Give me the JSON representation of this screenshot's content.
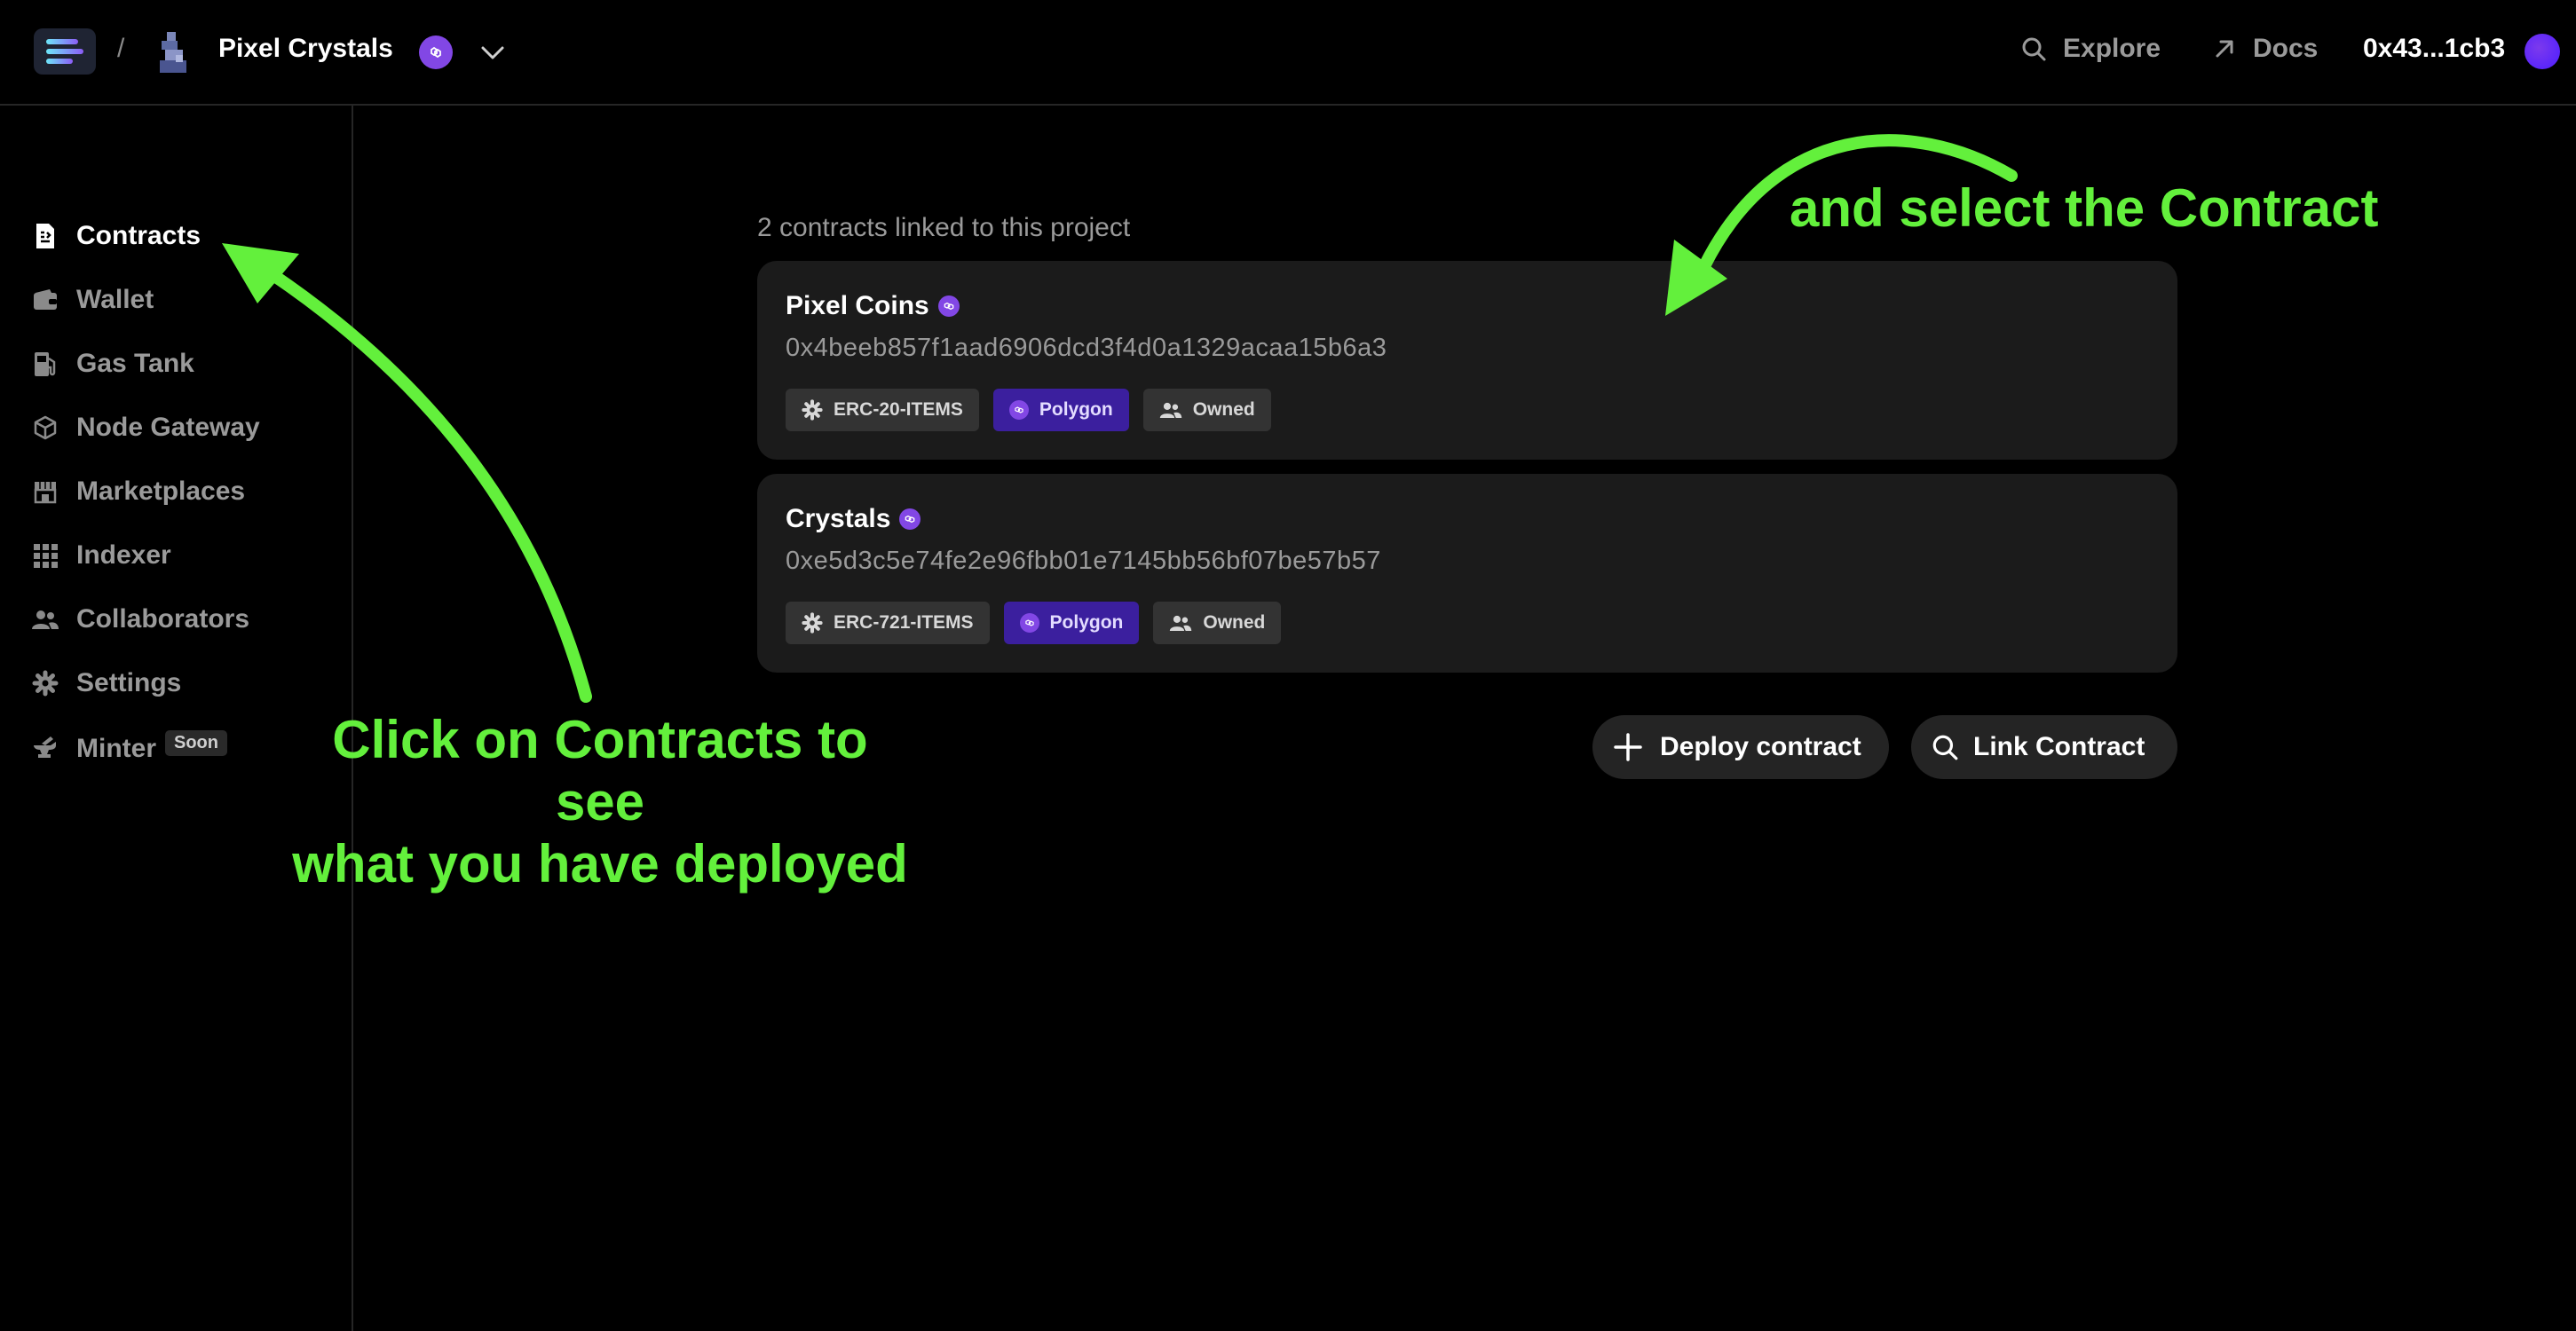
{
  "header": {
    "breadcrumb_sep": "/",
    "project_name": "Pixel Crystals",
    "explore_label": "Explore",
    "docs_label": "Docs",
    "wallet_address": "0x43...1cb3"
  },
  "sidebar": {
    "items": [
      {
        "label": "Contracts",
        "icon": "contracts-icon"
      },
      {
        "label": "Wallet",
        "icon": "wallet-icon"
      },
      {
        "label": "Gas Tank",
        "icon": "gas-pump-icon"
      },
      {
        "label": "Node Gateway",
        "icon": "cube-icon"
      },
      {
        "label": "Marketplaces",
        "icon": "storefront-icon"
      },
      {
        "label": "Indexer",
        "icon": "grid-icon"
      },
      {
        "label": "Collaborators",
        "icon": "users-icon"
      },
      {
        "label": "Settings",
        "icon": "gear-icon"
      },
      {
        "label": "Minter",
        "icon": "anvil-icon",
        "badge": "Soon"
      }
    ]
  },
  "main": {
    "caption": "2 contracts linked to this project",
    "contracts": [
      {
        "name": "Pixel Coins",
        "address": "0x4beeb857f1aad6906dcd3f4d0a1329acaa15b6a3",
        "tags": [
          "ERC-20-ITEMS",
          "Polygon",
          "Owned"
        ]
      },
      {
        "name": "Crystals",
        "address": "0xe5d3c5e74fe2e96fbb01e7145bb56bf07be57b57",
        "tags": [
          "ERC-721-ITEMS",
          "Polygon",
          "Owned"
        ]
      }
    ],
    "deploy_label": "Deploy contract",
    "link_label": "Link Contract"
  },
  "annotations": {
    "left_line1": "Click on Contracts to see",
    "left_line2": "what you have deployed",
    "right": "and select the Contract",
    "color": "#63f03c"
  },
  "colors": {
    "polygon": "#8247e5",
    "polygon_tag_bg": "#3b1f9e",
    "card_bg": "#1b1b1b"
  }
}
